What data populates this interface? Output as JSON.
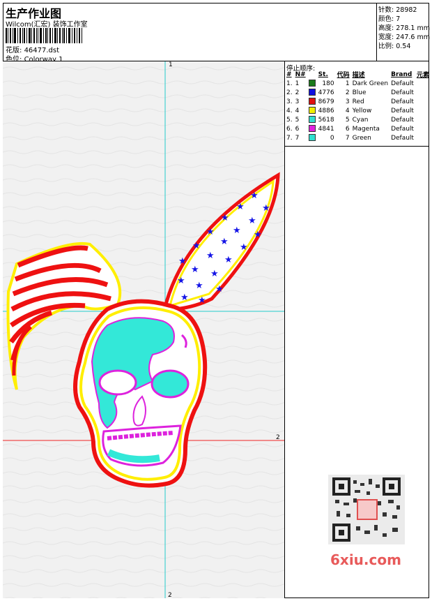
{
  "header": {
    "title": "生产作业图",
    "company": "Wilcom(汇宏) 装饰工作室",
    "design_label": "花版:",
    "design_value": "46477.dst",
    "color_label": "色位:",
    "color_value": "Colorway 1"
  },
  "specs": [
    {
      "label": "针数:",
      "value": "28982"
    },
    {
      "label": "颜色:",
      "value": "7"
    },
    {
      "label": "高度:",
      "value": "278.1 mm"
    },
    {
      "label": "宽度:",
      "value": "247.6 mm"
    },
    {
      "label": "比例:",
      "value": "0.54"
    }
  ],
  "stop_sequence": {
    "title": "停止顺序:",
    "headers": [
      "#",
      "N#",
      "St.",
      "代码",
      "描述",
      "Brand",
      "元素"
    ],
    "rows": [
      {
        "num": "1.",
        "n": "1",
        "color": "#1a7a1a",
        "st": "180",
        "code": "1",
        "desc": "Dark Green",
        "brand": "Default"
      },
      {
        "num": "2.",
        "n": "2",
        "color": "#1010e0",
        "st": "4776",
        "code": "2",
        "desc": "Blue",
        "brand": "Default"
      },
      {
        "num": "3.",
        "n": "3",
        "color": "#e01010",
        "st": "8679",
        "code": "3",
        "desc": "Red",
        "brand": "Default"
      },
      {
        "num": "4.",
        "n": "4",
        "color": "#f0f000",
        "st": "4886",
        "code": "4",
        "desc": "Yellow",
        "brand": "Default"
      },
      {
        "num": "5.",
        "n": "5",
        "color": "#30e0d0",
        "st": "5618",
        "code": "5",
        "desc": "Cyan",
        "brand": "Default"
      },
      {
        "num": "6.",
        "n": "6",
        "color": "#e020e0",
        "st": "4841",
        "code": "6",
        "desc": "Magenta",
        "brand": "Default"
      },
      {
        "num": "7.",
        "n": "7",
        "color": "#30e0d0",
        "st": "0",
        "code": "7",
        "desc": "Green",
        "brand": "Default"
      }
    ]
  },
  "axis_labels": {
    "top": "1",
    "right": "2",
    "bottom": "2"
  },
  "watermark": "6xiu.com",
  "colors": {
    "red": "#ee1111",
    "yellow": "#ffee00",
    "blue": "#1414e6",
    "cyan": "#33e8d8",
    "magenta": "#dd22dd"
  }
}
